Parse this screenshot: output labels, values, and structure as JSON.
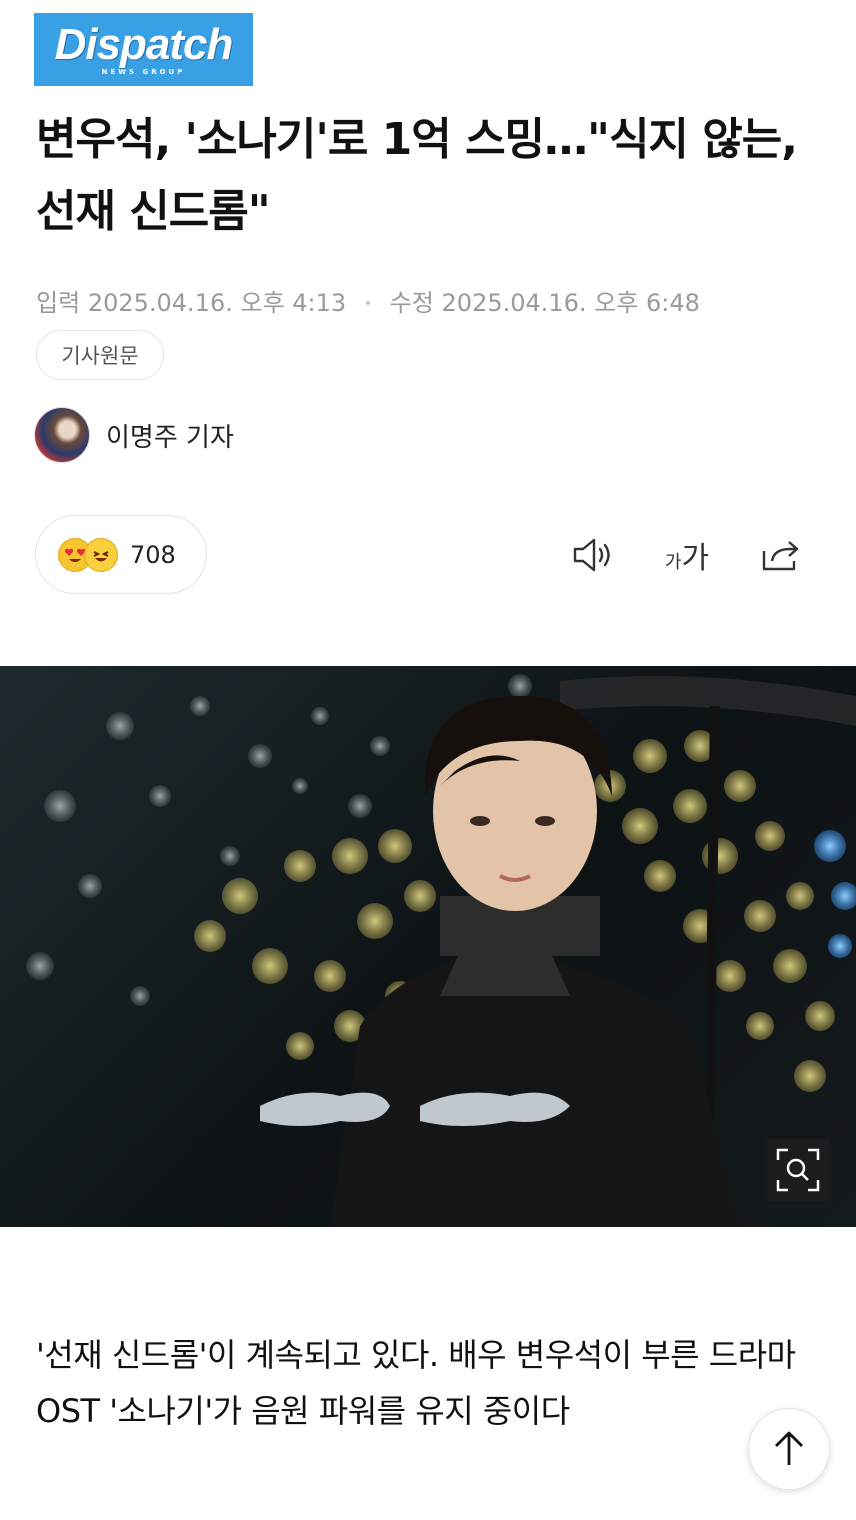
{
  "brand": {
    "logo_text": "Dispatch",
    "logo_subtext": "NEWS GROUP"
  },
  "article": {
    "title": "변우석, '소나기'로 1억 스밍…\"식지 않는, 선재 신드롬\"",
    "published_label": "입력",
    "published_value": "2025.04.16. 오후 4:13",
    "modified_label": "수정",
    "modified_value": "2025.04.16. 오후 6:48",
    "original_button": "기사원문",
    "author": "이명주 기자",
    "body": "'선재 신드롬'이 계속되고 있다. 배우 변우석이 부른 드라마 OST '소나기'가 음원 파워를 유지 중이다"
  },
  "reaction": {
    "count": "708"
  },
  "toolbar": {
    "font_small": "가",
    "font_large": "가"
  },
  "icons": [
    "heart-eyes-emoji-icon",
    "laughing-emoji-icon",
    "speaker-icon",
    "font-size-icon",
    "share-icon",
    "zoom-icon",
    "arrow-up-icon"
  ],
  "colors": {
    "brand": "#3aa0e4",
    "meta_text": "#9a9a9a",
    "emoji_yellow": "#f7c531"
  }
}
